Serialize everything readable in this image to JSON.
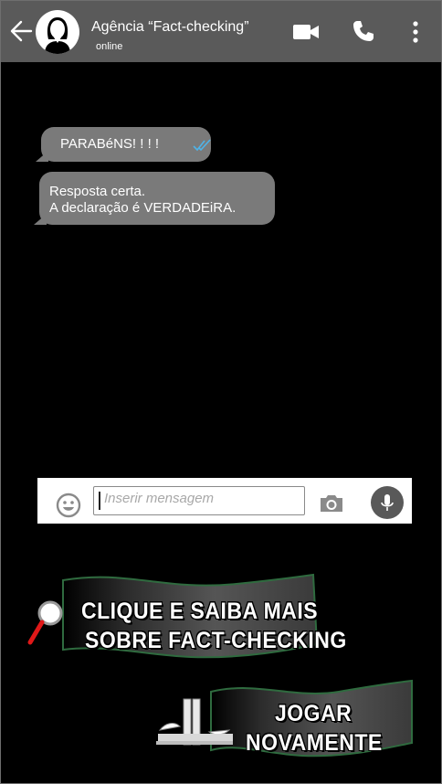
{
  "header": {
    "contact_name": "Agência “Fact-checking”",
    "status": "online",
    "back_icon": "arrow-left-icon",
    "video_icon": "video-camera-icon",
    "call_icon": "phone-icon",
    "menu_icon": "more-vertical-icon",
    "bg_color": "#5a5a5a"
  },
  "messages": [
    {
      "text": "PARABéNS! ! ! !",
      "read_icon": "double-check-icon"
    },
    {
      "line1": "Resposta certa.",
      "line2": "A  declaração é VERDADEiRA."
    }
  ],
  "composer": {
    "placeholder": "Inserir mensagem",
    "emoji_icon": "emoji-icon",
    "camera_icon": "camera-icon",
    "mic_icon": "microphone-icon"
  },
  "cta_learn": {
    "line1": "CLIQUE E SAIBA MAIS",
    "line2": "SOBRE FACT-CHECKING",
    "icon": "magnifier-icon"
  },
  "cta_replay": {
    "line1": "JOGAR",
    "line2": "NOVAMENTE",
    "icon": "congress-building-icon"
  },
  "colors": {
    "bubble": "#7a7a7a",
    "banner_green": "#2f6b3f",
    "tick_blue": "#4fb3e8"
  }
}
